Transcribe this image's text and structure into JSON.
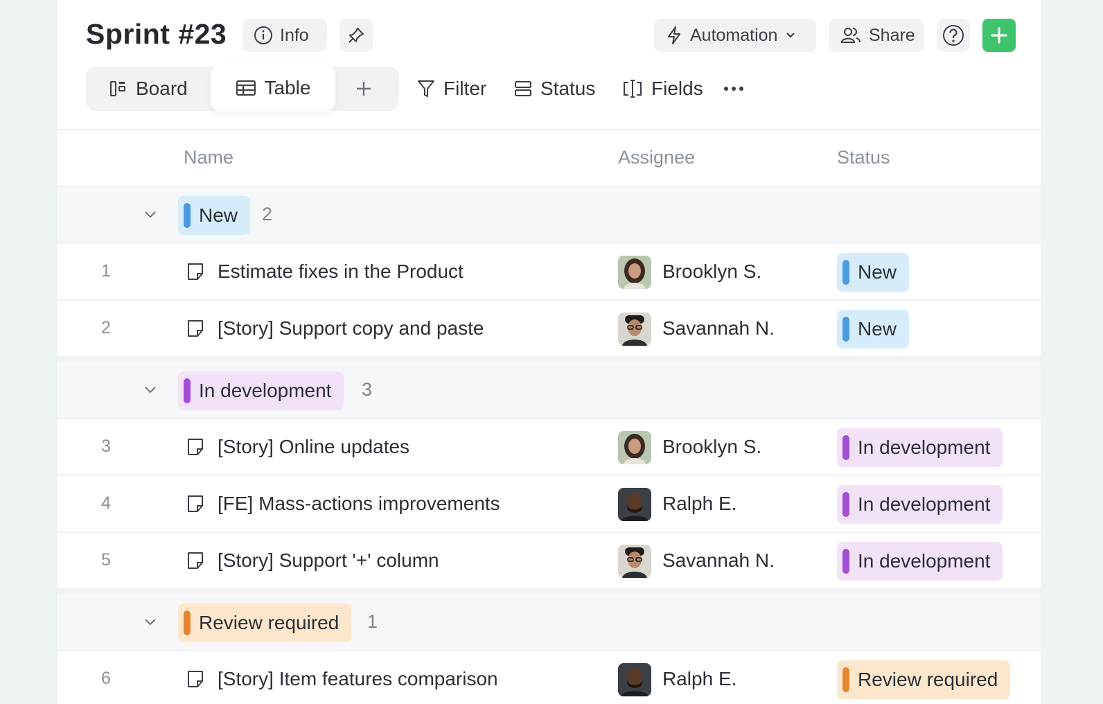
{
  "header": {
    "title": "Sprint #23",
    "info_label": "Info",
    "automation_label": "Automation",
    "share_label": "Share"
  },
  "views": {
    "board_label": "Board",
    "table_label": "Table"
  },
  "toolbar": {
    "filter_label": "Filter",
    "status_label": "Status",
    "fields_label": "Fields"
  },
  "columns": {
    "name": "Name",
    "assignee": "Assignee",
    "status": "Status"
  },
  "colors": {
    "new_bg": "#d6ecfb",
    "new_bar": "#4b9be2",
    "dev_bg": "#f2e2f8",
    "dev_bar": "#a14fd4",
    "review_bg": "#fde7cc",
    "review_bar": "#e4852f",
    "add_button": "#3ec46d"
  },
  "groups": [
    {
      "label": "New",
      "count": "2"
    },
    {
      "label": "In development",
      "count": "3"
    },
    {
      "label": "Review required",
      "count": "1"
    }
  ],
  "rows": [
    {
      "num": "1",
      "name": "Estimate fixes in the Product",
      "assignee": "Brooklyn S.",
      "status": "New"
    },
    {
      "num": "2",
      "name": "[Story] Support copy and paste",
      "assignee": "Savannah N.",
      "status": "New"
    },
    {
      "num": "3",
      "name": "[Story] Online updates",
      "assignee": "Brooklyn S.",
      "status": "In development"
    },
    {
      "num": "4",
      "name": "[FE] Mass-actions improvements",
      "assignee": "Ralph E.",
      "status": "In development"
    },
    {
      "num": "5",
      "name": "[Story] Support '+' column",
      "assignee": "Savannah N.",
      "status": "In development"
    },
    {
      "num": "6",
      "name": "[Story] Item features comparison",
      "assignee": "Ralph E.",
      "status": "Review required"
    }
  ]
}
